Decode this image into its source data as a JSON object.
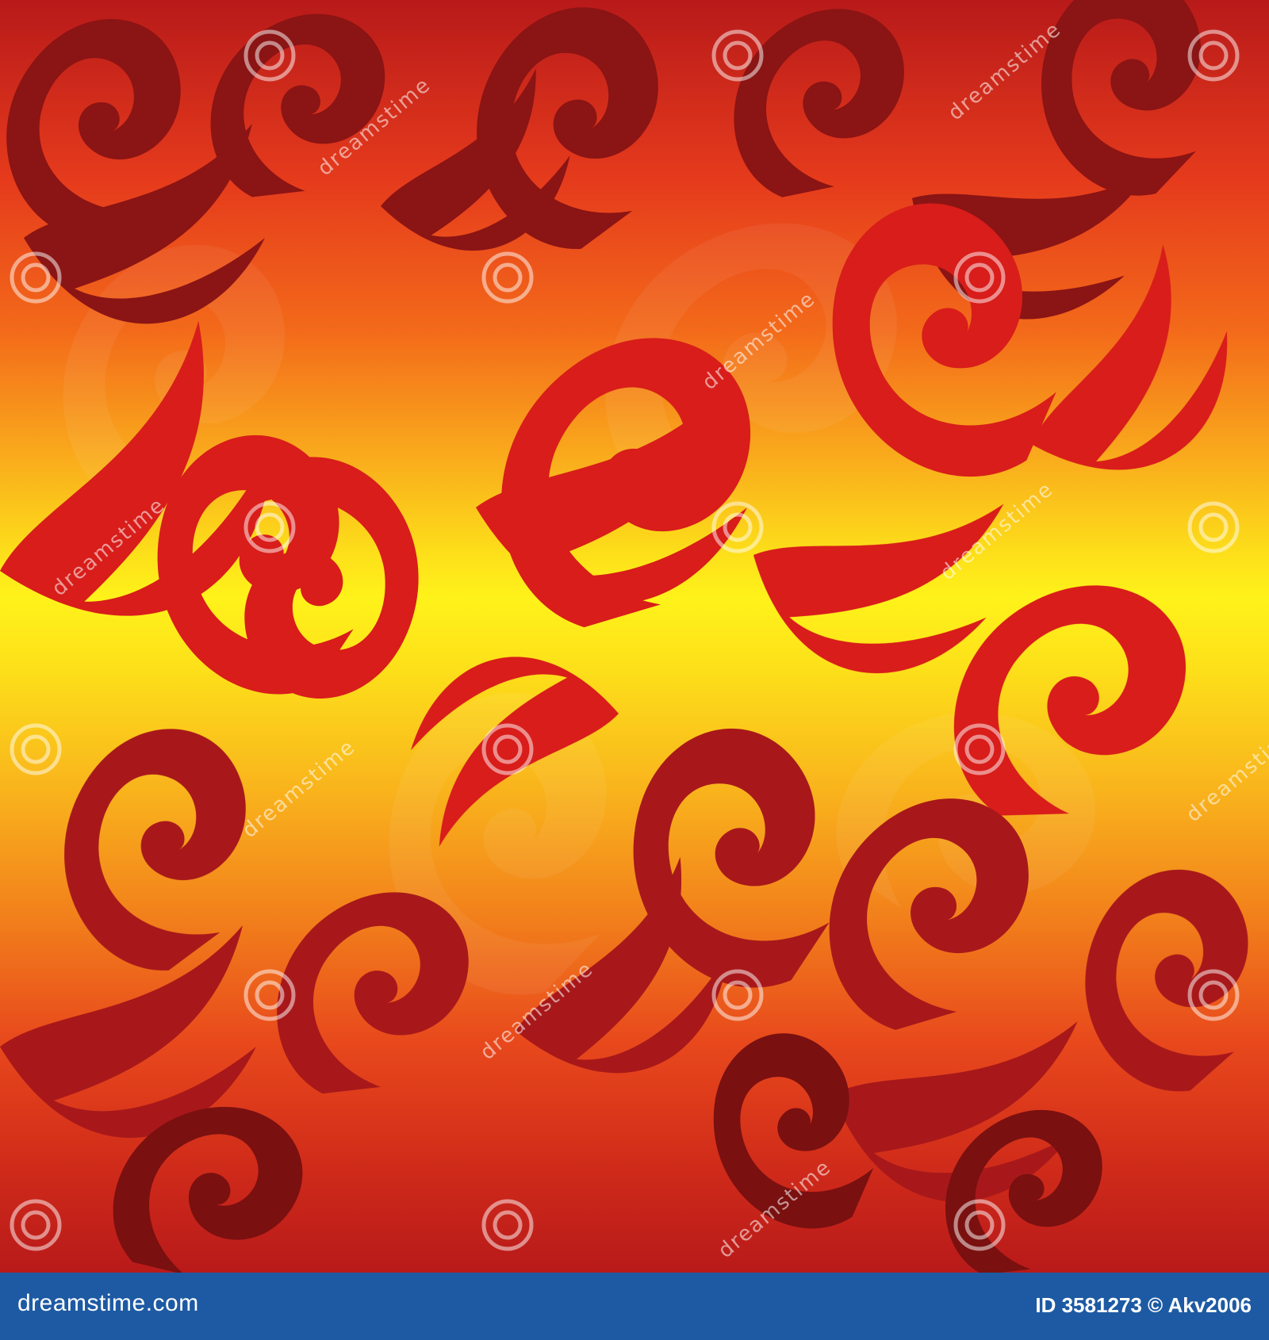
{
  "image": {
    "subject": "seamless red and yellow fire swirl pattern",
    "colors": {
      "dark_red": "#8b1414",
      "red": "#d81d1a",
      "orange": "#f37a1b",
      "yellow": "#fff21a",
      "footer_blue": "#1d5aa3"
    }
  },
  "watermark": {
    "text": "dreamstime",
    "logo": "dreamstime-spiral-icon"
  },
  "footer": {
    "site": "dreamstime.com",
    "id": "ID 3581273 © Akv2006"
  }
}
